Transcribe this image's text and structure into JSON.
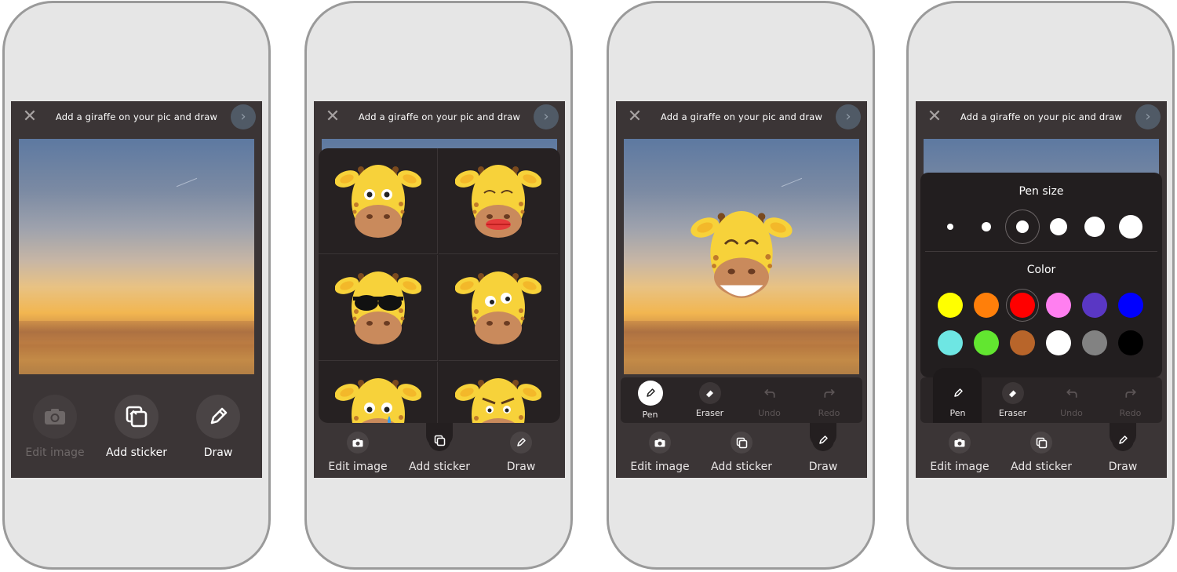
{
  "app": {
    "title": "Add a giraffe on your pic and draw",
    "close_glyph": "✕",
    "next_glyph": "›"
  },
  "main_tools": [
    {
      "label": "Edit image",
      "icon": "camera-icon",
      "enabled": false
    },
    {
      "label": "Add sticker",
      "icon": "sticker-icon",
      "enabled": true
    },
    {
      "label": "Draw",
      "icon": "pen-icon",
      "enabled": true
    }
  ],
  "tabs": [
    {
      "label": "Edit image",
      "icon": "camera-icon"
    },
    {
      "label": "Add sticker",
      "icon": "sticker-icon"
    },
    {
      "label": "Draw",
      "icon": "pen-icon"
    }
  ],
  "draw_tools": [
    {
      "label": "Pen",
      "icon": "pen-icon",
      "enabled": true
    },
    {
      "label": "Eraser",
      "icon": "eraser-icon",
      "enabled": true
    },
    {
      "label": "Undo",
      "icon": "undo-icon",
      "enabled": false
    },
    {
      "label": "Redo",
      "icon": "redo-icon",
      "enabled": false
    }
  ],
  "stickers": [
    {
      "name": "giraffe-surprised"
    },
    {
      "name": "giraffe-lips"
    },
    {
      "name": "giraffe-sunglasses"
    },
    {
      "name": "giraffe-googly"
    },
    {
      "name": "giraffe-crying"
    },
    {
      "name": "giraffe-angry"
    }
  ],
  "pen_panel": {
    "size_title": "Pen size",
    "color_title": "Color",
    "selected_size_index": 2,
    "selected_color_index": 2,
    "colors": [
      "#ffff00",
      "#ff7f0a",
      "#ff0000",
      "#ff7ff0",
      "#5a37c4",
      "#0000ff",
      "#6ee6e3",
      "#62e630",
      "#b8652a",
      "#ffffff",
      "#828282",
      "#000000"
    ]
  },
  "colors": {
    "screen_bg": "#3b3536",
    "giraffe_yellow": "#f7d23a",
    "giraffe_muzzle": "#c98a5c"
  }
}
